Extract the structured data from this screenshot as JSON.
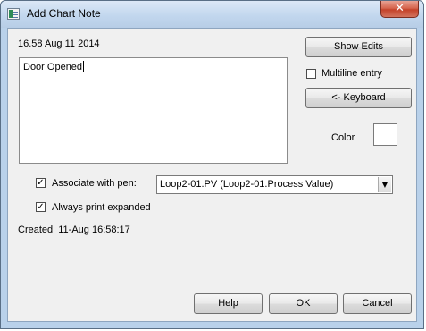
{
  "window": {
    "title": "Add Chart Note",
    "close_glyph": "✕"
  },
  "note": {
    "timestamp": "16.58 Aug 11 2014",
    "text": "Door Opened"
  },
  "buttons": {
    "show_edits": "Show Edits",
    "keyboard": "<- Keyboard",
    "help": "Help",
    "ok": "OK",
    "cancel": "Cancel"
  },
  "options": {
    "multiline_label": "Multiline entry",
    "multiline_checked": false,
    "color_label": "Color",
    "color_value": "#ffffff",
    "associate_label": "Associate with pen:",
    "associate_checked": true,
    "pen_selected": "Loop2-01.PV (Loop2-01.Process Value)",
    "always_print_label": "Always print expanded",
    "always_print_checked": true
  },
  "footer": {
    "created": "Created  11-Aug 16:58:17"
  },
  "icons": {
    "app": "chart-note-app-icon",
    "close": "close-icon",
    "dropdown": "chevron-down-icon",
    "check": "checkmark-icon"
  }
}
